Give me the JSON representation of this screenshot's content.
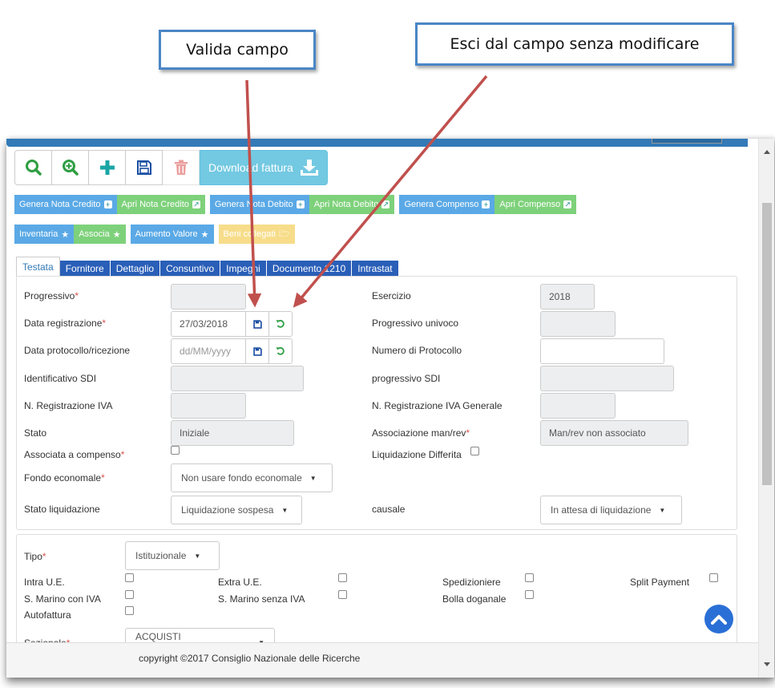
{
  "callouts": {
    "validate": "Valida campo",
    "exit": "Esci dal campo senza modificare"
  },
  "toolbar": {
    "search_icon": "search-icon",
    "zoom_icon": "zoom-in-icon",
    "add_icon": "plus-icon",
    "save_icon": "save-icon",
    "delete_icon": "trash-icon",
    "download_label": "Download fattura"
  },
  "row1": {
    "genera_nota_credito": "Genera Nota Credito",
    "apri_nota_credito": "Apri Nota Credito",
    "genera_nota_debito": "Genera Nota Debito",
    "apri_nota_debito": "Apri Nota Debito",
    "genera_compenso": "Genera Compenso",
    "apri_compenso": "Apri Compenso"
  },
  "row2": {
    "inventaria": "Inventaria",
    "associa": "Associa",
    "aumento_valore": "Aumento Valore",
    "beni_collegati": "Beni collegati"
  },
  "tabs": [
    "Testata",
    "Fornitore",
    "Dettaglio",
    "Consuntivo",
    "Impegni",
    "Documento 1210",
    "Intrastat"
  ],
  "form": {
    "progressivo": "Progressivo",
    "data_registrazione": "Data registrazione",
    "data_registrazione_value": "27/03/2018",
    "data_protocollo": "Data protocollo/ricezione",
    "data_protocollo_placeholder": "dd/MM/yyyy",
    "identificativo_sdi": "Identificativo SDI",
    "n_registrazione_iva": "N. Registrazione IVA",
    "stato": "Stato",
    "stato_value": "Iniziale",
    "associata_compenso": "Associata a compenso",
    "fondo_economale": "Fondo economale",
    "fondo_economale_value": "Non usare fondo economale",
    "stato_liquidazione": "Stato liquidazione",
    "stato_liquidazione_value": "Liquidazione sospesa",
    "esercizio": "Esercizio",
    "esercizio_value": "2018",
    "progressivo_univoco": "Progressivo univoco",
    "numero_protocollo": "Numero di Protocollo",
    "progressivo_sdi": "progressivo SDI",
    "n_registrazione_iva_generale": "N. Registrazione IVA Generale",
    "associazione_man_rev": "Associazione man/rev",
    "associazione_man_rev_value": "Man/rev non associato",
    "liquidazione_differita": "Liquidazione Differita",
    "causale": "causale",
    "causale_value": "In attesa di liquidazione"
  },
  "tipo": {
    "tipo_label": "Tipo",
    "tipo_value": "Istituzionale",
    "intra_ue": "Intra U.E.",
    "extra_ue": "Extra U.E.",
    "spedizioniere": "Spedizioniere",
    "split_payment": "Split Payment",
    "s_marino_con_iva": "S. Marino con IVA",
    "s_marino_senza_iva": "S. Marino senza IVA",
    "bolla_doganale": "Bolla doganale",
    "autofattura": "Autofattura",
    "sezionale_label": "Sezionale",
    "sezionale_value": "ACQUISTI ISTITUZIONALE"
  },
  "footer": {
    "copyright": "copyright ©2017 Consiglio Nazionale delle Ricerche"
  },
  "colors": {
    "primary": "#337ab7",
    "info": "#5aa9e6",
    "success": "#7ed17b",
    "warning": "#f7dd8a",
    "arrow": "#c0504d",
    "callout_border": "#4a86c6"
  }
}
